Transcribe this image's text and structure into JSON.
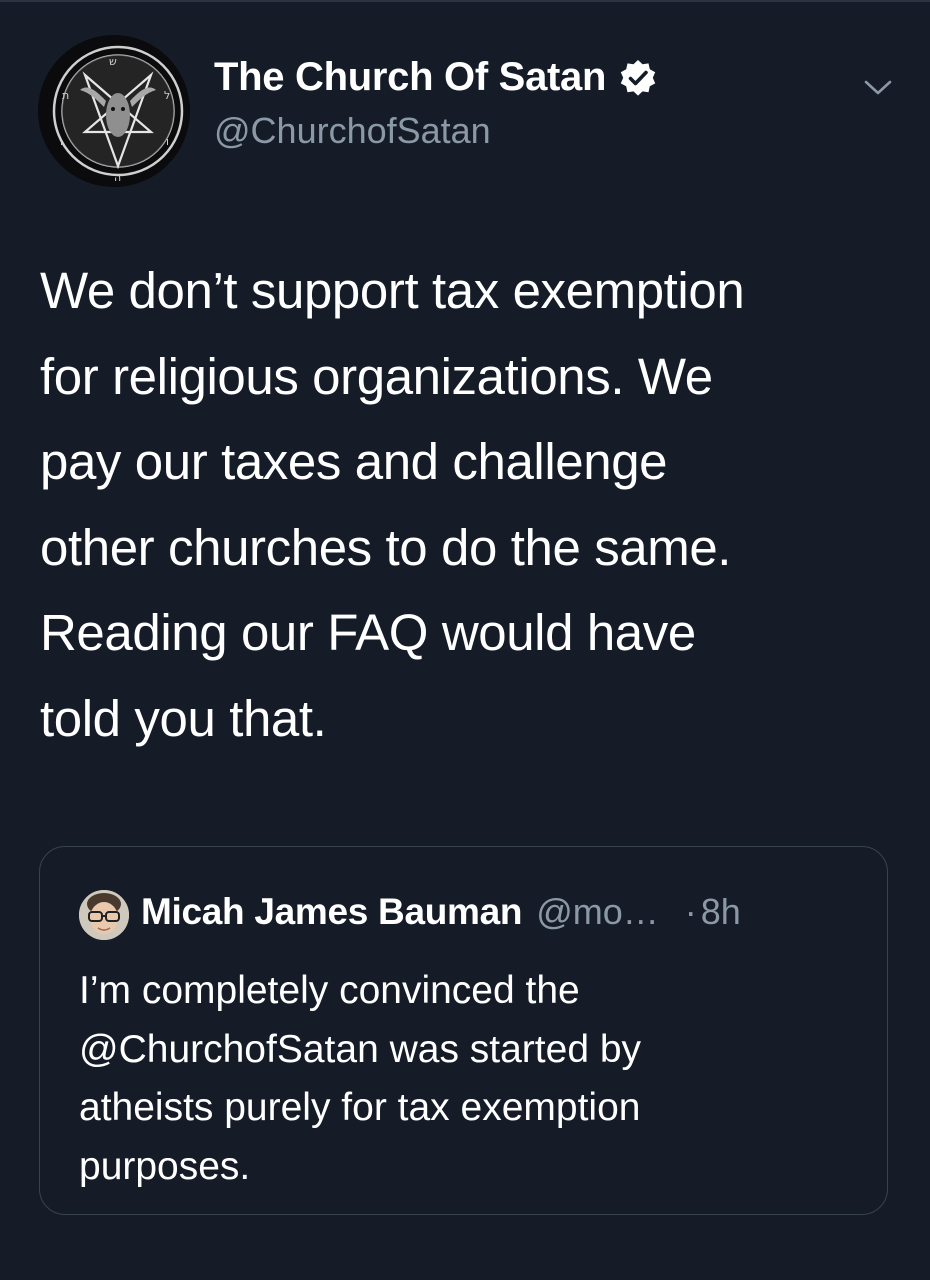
{
  "tweet": {
    "author": {
      "display_name": "The Church Of Satan",
      "handle": "@ChurchofSatan",
      "verified": true,
      "avatar_icon": "baphomet-sigil-icon"
    },
    "menu_icon": "chevron-down-icon",
    "text_lines": [
      "We don’t support tax exemption",
      "for religious organizations. We",
      "pay our taxes and challenge",
      "other churches to do the same.",
      "Reading our FAQ would have",
      "told you that."
    ],
    "quoted_tweet": {
      "author": {
        "display_name": "Micah James Bauman",
        "handle": "@mo…",
        "avatar_icon": "user-avatar-icon"
      },
      "separator": "·",
      "timestamp": "8h",
      "text_lines": [
        "I’m completely convinced the",
        "@ChurchofSatan was started by",
        "atheists purely for tax exemption",
        "purposes."
      ]
    }
  },
  "colors": {
    "background": "#151c28",
    "primary_text": "#ffffff",
    "secondary_text": "#8b98a5",
    "card_border": "#38444d"
  }
}
